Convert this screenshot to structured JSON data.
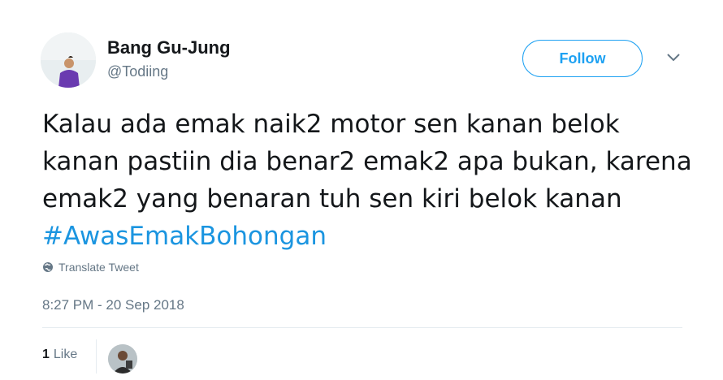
{
  "user": {
    "display_name": "Bang Gu-Jung",
    "handle": "@Todiing"
  },
  "header": {
    "follow_label": "Follow",
    "menu_icon": "chevron-down-icon"
  },
  "tweet": {
    "text_before_hashtag": "Kalau ada emak naik2 motor sen kanan belok kanan pastiin dia benar2 emak2 apa bukan, karena emak2 yang benaran tuh sen kiri belok kanan ",
    "hashtag": "#AwasEmakBohongan",
    "translate_label": "Translate Tweet",
    "translate_icon": "globe-icon",
    "timestamp": "8:27 PM - 20 Sep 2018"
  },
  "stats": {
    "like_count": "1",
    "like_label": "Like"
  },
  "colors": {
    "accent": "#1da1f2",
    "hashtag": "#1b95e0",
    "muted": "#657786",
    "divider": "#e6ecf0"
  }
}
